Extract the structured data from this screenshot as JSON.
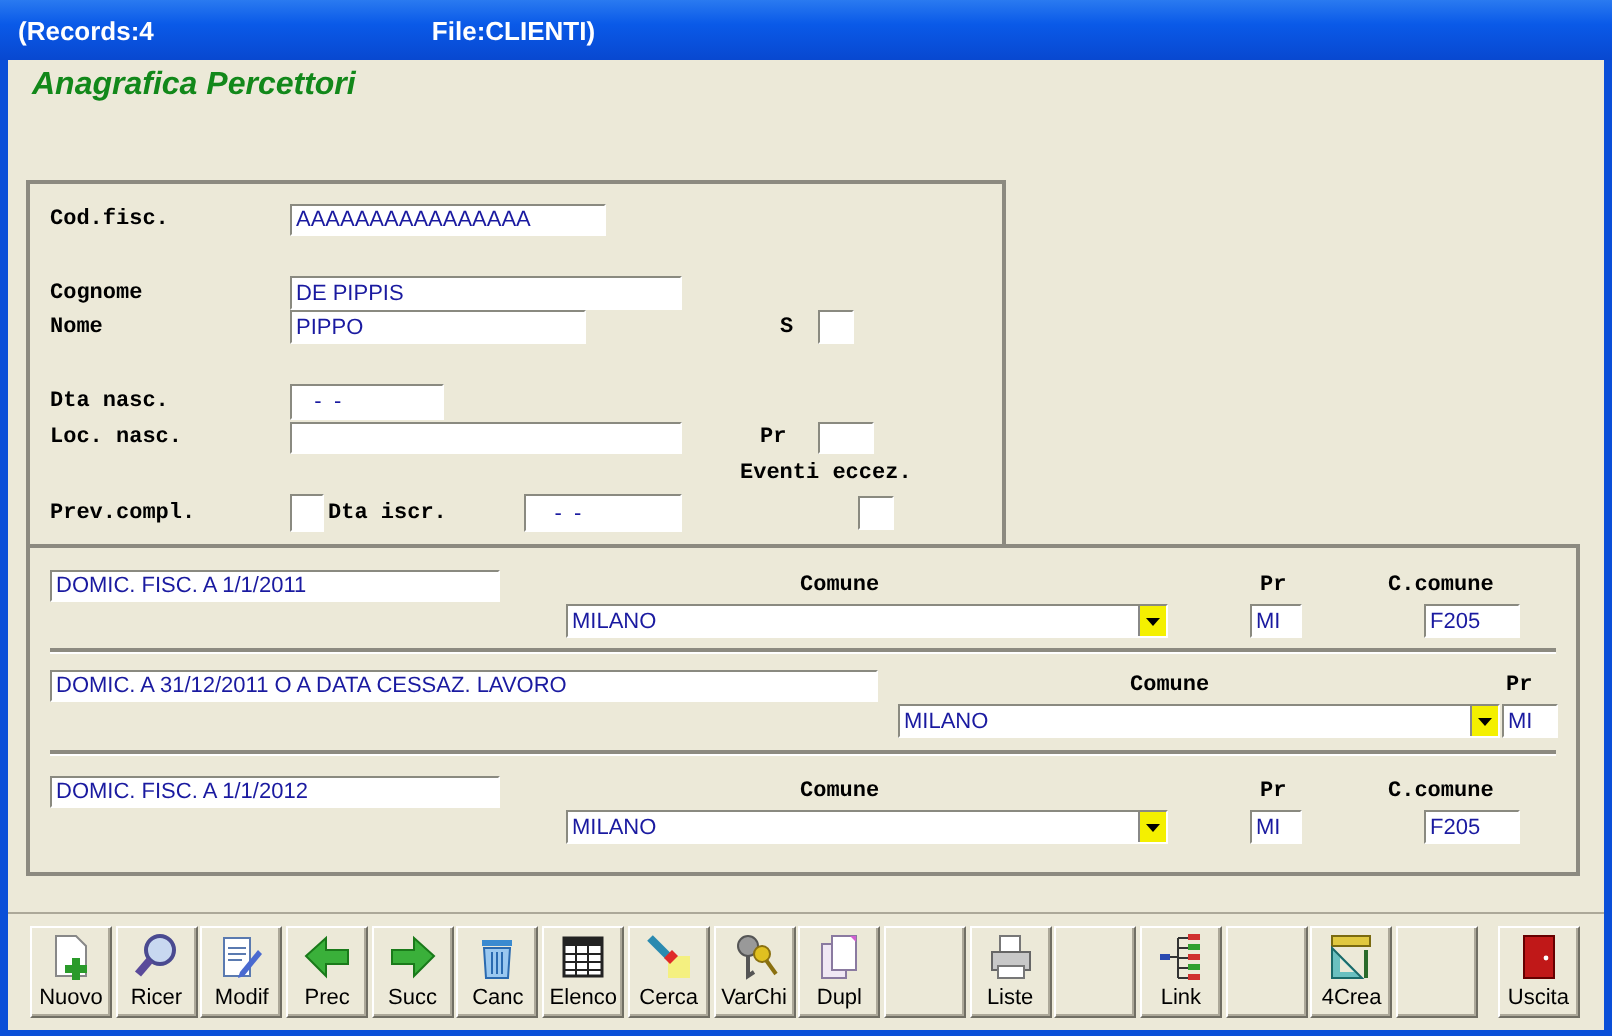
{
  "window": {
    "records": "(Records:4",
    "file": "File:CLIENTI)"
  },
  "form_title": "Anagrafica Percettori",
  "personal": {
    "cod_fisc": {
      "label": "Cod.fisc.",
      "value": "AAAAAAAAAAAAAAAA"
    },
    "cognome": {
      "label": "Cognome",
      "value": "DE PIPPIS"
    },
    "nome": {
      "label": "Nome",
      "value": "PIPPO"
    },
    "sesso": {
      "label": "S"
    },
    "dta_nasc": {
      "label": "Dta nasc.",
      "value": "-  -"
    },
    "loc_nasc": {
      "label": "Loc. nasc."
    },
    "pr": {
      "label": "Pr"
    },
    "eventi_eccez": {
      "label": "Eventi eccez.",
      "checked": false
    },
    "prev_compl": {
      "label": "Prev.compl.",
      "checked": false
    },
    "dta_iscr": {
      "label": "Dta iscr.",
      "value": "-  -"
    }
  },
  "addresses": [
    {
      "kind": "standard",
      "description": "DOMIC. FISC. A 1/1/2011",
      "comune_label": "Comune",
      "comune": "MILANO",
      "pr_label": "Pr",
      "pr": "MI",
      "c_comune_label": "C.comune",
      "c_comune": "F205"
    },
    {
      "kind": "wide",
      "description": "DOMIC. A 31/12/2011 O A DATA CESSAZ. LAVORO",
      "comune_label": "Comune",
      "comune": "MILANO",
      "pr_label": "Pr",
      "pr": "MI"
    },
    {
      "kind": "standard",
      "description": "DOMIC. FISC. A 1/1/2012",
      "comune_label": "Comune",
      "comune": "MILANO",
      "pr_label": "Pr",
      "pr": "MI",
      "c_comune_label": "C.comune",
      "c_comune": "F205"
    }
  ],
  "toolbar": [
    {
      "kind": "new",
      "label": "Nuovo"
    },
    {
      "kind": "search",
      "label": "Ricer"
    },
    {
      "kind": "edit",
      "label": "Modif"
    },
    {
      "kind": "prev",
      "label": "Prec"
    },
    {
      "kind": "next",
      "label": "Succ"
    },
    {
      "kind": "delete",
      "label": "Canc"
    },
    {
      "kind": "list",
      "label": "Elenco"
    },
    {
      "kind": "find",
      "label": "Cerca"
    },
    {
      "kind": "keys",
      "label": "VarChi"
    },
    {
      "kind": "duplicate",
      "label": "Dupl"
    },
    {
      "kind": "blank"
    },
    {
      "kind": "print",
      "label": "Liste"
    },
    {
      "kind": "blank"
    },
    {
      "kind": "link",
      "label": "Link"
    },
    {
      "kind": "blank"
    },
    {
      "kind": "tools",
      "label": "4Crea"
    },
    {
      "kind": "blank"
    },
    {
      "kind": "exit",
      "label": "Uscita"
    }
  ]
}
